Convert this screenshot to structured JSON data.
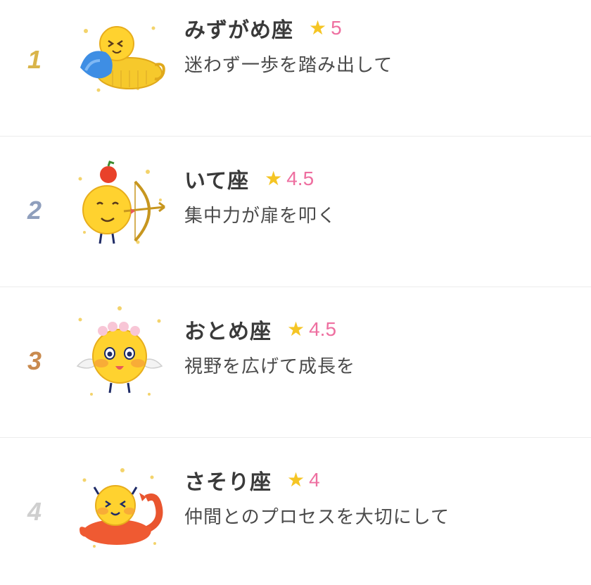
{
  "items": [
    {
      "rank": "1",
      "rank_color": "#d9b44a",
      "name": "みずがめ座",
      "score": "5",
      "message": "迷わず一歩を踏み出して",
      "icon": "aquarius-character-icon"
    },
    {
      "rank": "2",
      "rank_color": "#8f9fbd",
      "name": "いて座",
      "score": "4.5",
      "message": "集中力が扉を叩く",
      "icon": "sagittarius-character-icon"
    },
    {
      "rank": "3",
      "rank_color": "#c98a4e",
      "name": "おとめ座",
      "score": "4.5",
      "message": "視野を広げて成長を",
      "icon": "virgo-character-icon"
    },
    {
      "rank": "4",
      "rank_color": "#cfcfcf",
      "name": "さそり座",
      "score": "4",
      "message": "仲間とのプロセスを大切にして",
      "icon": "scorpio-character-icon"
    }
  ],
  "colors": {
    "star": "#f5c524",
    "score": "#ee6fa0",
    "name": "#3a3a3a",
    "message": "#4a4a4a"
  }
}
